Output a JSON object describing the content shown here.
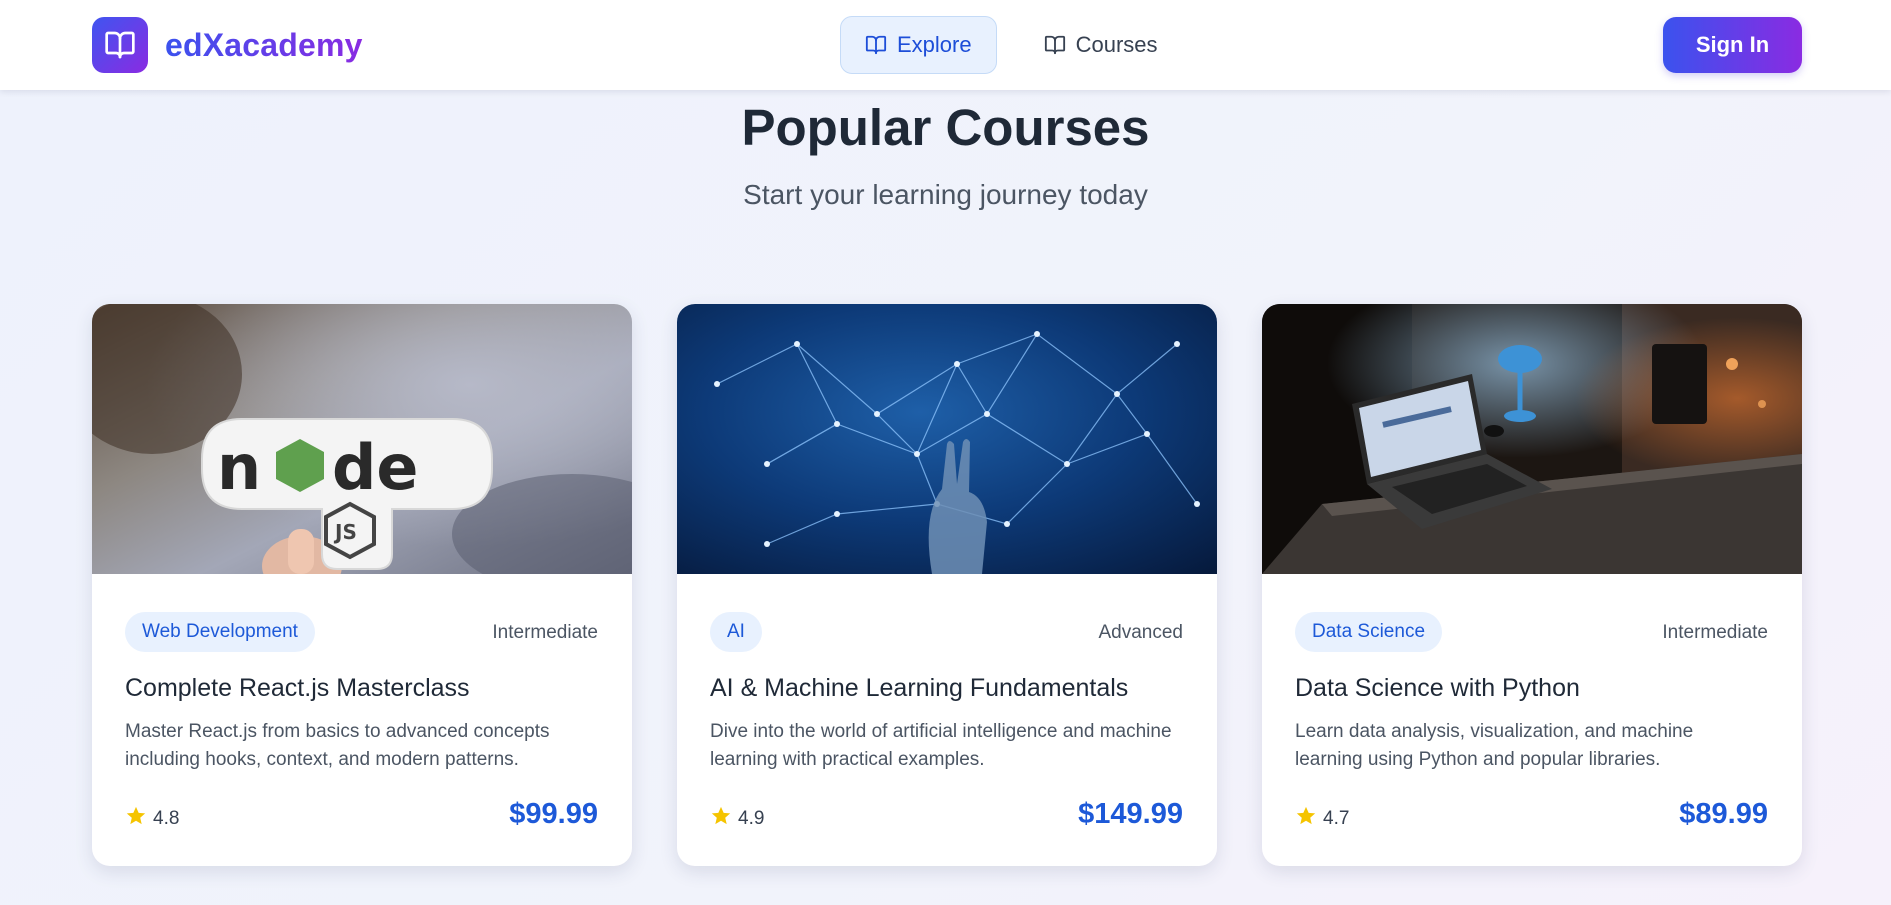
{
  "header": {
    "brand": "edXacademy",
    "nav": [
      {
        "label": "Explore",
        "icon": "book-open-icon",
        "active": true
      },
      {
        "label": "Courses",
        "icon": "book-open-icon",
        "active": false
      }
    ],
    "sign_in_label": "Sign In"
  },
  "hero": {
    "title": "Popular Courses",
    "subtitle": "Start your learning journey today"
  },
  "courses": [
    {
      "category": "Web Development",
      "level": "Intermediate",
      "title": "Complete React.js Masterclass",
      "description": "Master React.js from basics to advanced concepts including hooks, context, and modern patterns.",
      "rating": "4.8",
      "price": "$99.99",
      "image": "node-js-sticker-photo"
    },
    {
      "category": "AI",
      "level": "Advanced",
      "title": "AI & Machine Learning Fundamentals",
      "description": "Dive into the world of artificial intelligence and machine learning with practical examples.",
      "rating": "4.9",
      "price": "$149.99",
      "image": "robot-hand-network-photo"
    },
    {
      "category": "Data Science",
      "level": "Intermediate",
      "title": "Data Science with Python",
      "description": "Learn data analysis, visualization, and machine learning using Python and popular libraries.",
      "rating": "4.7",
      "price": "$89.99",
      "image": "laptop-desk-at-night-photo"
    }
  ],
  "colors": {
    "brand_start": "#3b52ee",
    "brand_end": "#8a2be2",
    "accent_blue": "#1d59d8",
    "star": "#f5c400"
  }
}
